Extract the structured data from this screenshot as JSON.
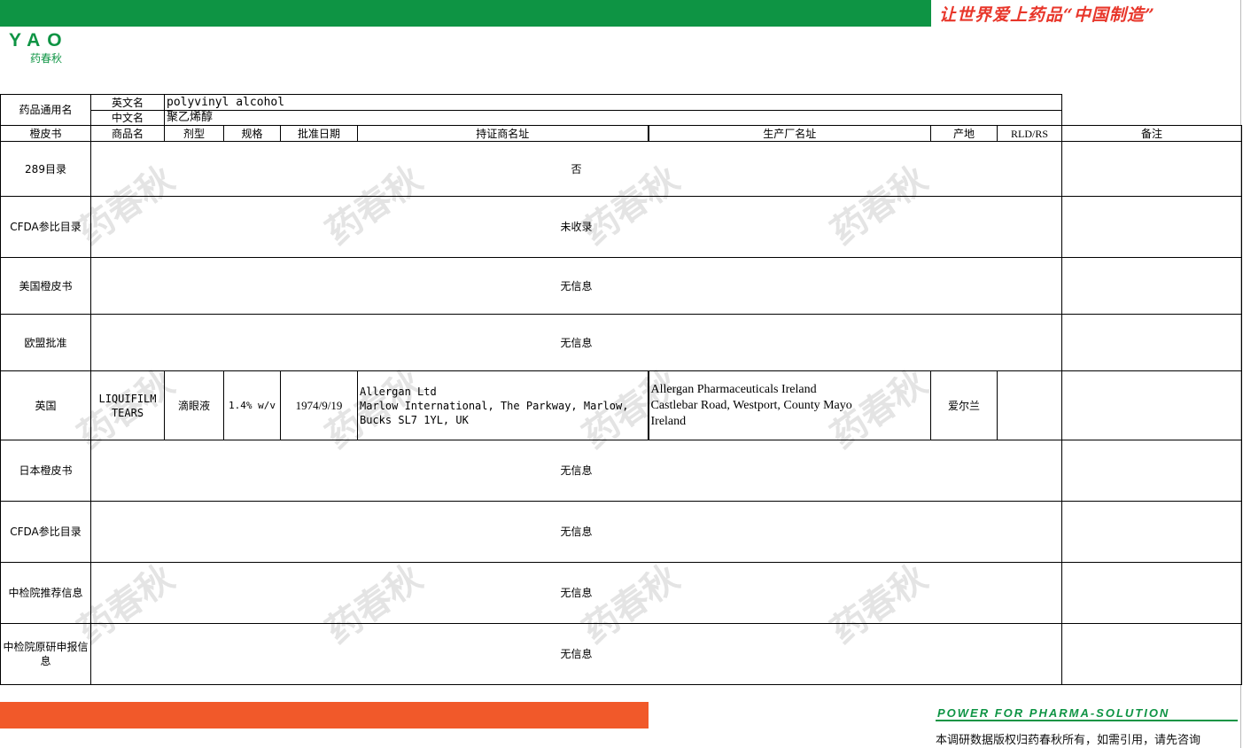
{
  "header": {
    "slogan": "让世界爱上药品“中国制造”",
    "logo_text": "YAO",
    "logo_sub": "药春秋"
  },
  "footer": {
    "power_text": "POWER FOR PHARMA-SOLUTION",
    "copyright": "本调研数据版权归药春秋所有，如需引用，请先咨询"
  },
  "watermark": "药春秋",
  "colors": {
    "green": "#0e9444",
    "orange": "#f1592a",
    "slogan_red": "#e8362a"
  },
  "table": {
    "generic_name_label": "药品通用名",
    "en_label": "英文名",
    "en_value": "polyvinyl alcohol",
    "cn_label": "中文名",
    "cn_value": "聚乙烯醇",
    "headers": {
      "orange_book": "橙皮书",
      "trade_name": "商品名",
      "dosage_form": "剂型",
      "strength": "规格",
      "approval_date": "批准日期",
      "holder": "持证商名址",
      "manufacturer": "生产厂名址",
      "origin": "产地",
      "rld_rs": "RLD/RS",
      "remarks": "备注"
    },
    "rows": {
      "r289": {
        "label": "289目录",
        "value": "否"
      },
      "cfda1": {
        "label": "CFDA参比目录",
        "value": "未收录"
      },
      "us": {
        "label": "美国橙皮书",
        "value": "无信息"
      },
      "eu": {
        "label": "欧盟批准",
        "value": "无信息"
      },
      "uk": {
        "label": "英国",
        "trade_name": "LIQUIFILM TEARS",
        "dosage_form": "滴眼液",
        "strength": "1.4% w/v",
        "approval_date": "1974/9/19",
        "holder_line1": "Allergan Ltd",
        "holder_line2": "Marlow International, The Parkway, Marlow,",
        "holder_line3": "Bucks SL7 1YL, UK",
        "mfr_line1": "Allergan Pharmaceuticals Ireland",
        "mfr_line2": "Castlebar Road, Westport, County Mayo",
        "mfr_line3": "Ireland",
        "origin": "爱尔兰",
        "rld_rs": "",
        "remarks": ""
      },
      "jp": {
        "label": "日本橙皮书",
        "value": "无信息"
      },
      "cfda2": {
        "label": "CFDA参比目录",
        "value": "无信息"
      },
      "nifdc_rec": {
        "label": "中检院推荐信息",
        "value": "无信息"
      },
      "nifdc_orig": {
        "label": "中检院原研申报信息",
        "value": "无信息"
      }
    }
  }
}
